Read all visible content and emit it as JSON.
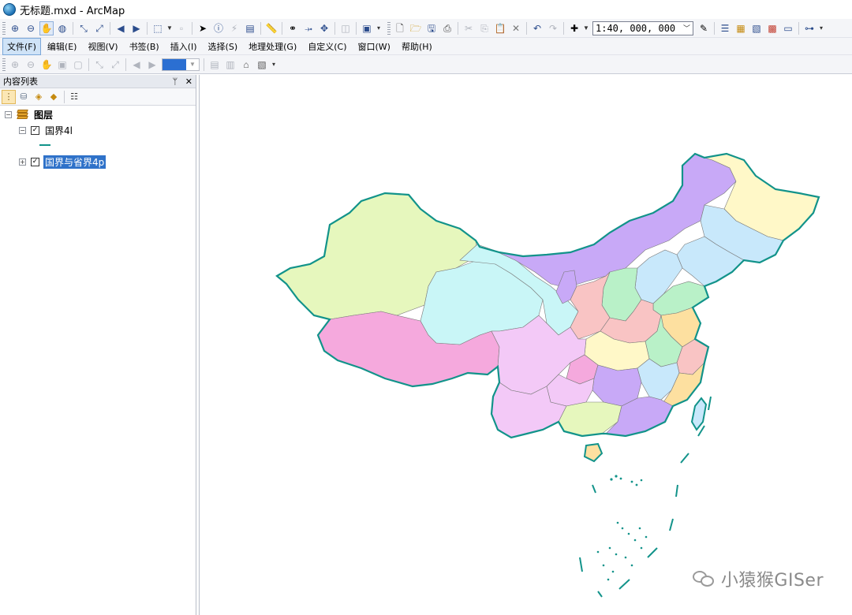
{
  "window": {
    "title": "无标题.mxd - ArcMap"
  },
  "menubar": {
    "items": [
      "文件(F)",
      "编辑(E)",
      "视图(V)",
      "书签(B)",
      "插入(I)",
      "选择(S)",
      "地理处理(G)",
      "自定义(C)",
      "窗口(W)",
      "帮助(H)"
    ],
    "active_index": 0
  },
  "standard_toolbar": {
    "scale_value": "1:40, 000, 000"
  },
  "toc": {
    "title": "内容列表",
    "layers_root": "图层",
    "layers": [
      {
        "name": "国界4l",
        "checked": true,
        "expanded": true,
        "symbol_color": "#12938a"
      },
      {
        "name": "国界与省界4p",
        "checked": true,
        "expanded": false,
        "selected": true
      }
    ]
  },
  "map": {
    "boundary_color": "#12938a",
    "province_colors": [
      "#e6f7bd",
      "#f5a9dd",
      "#c9f6f7",
      "#c8a9f7",
      "#fff8c8",
      "#c8e8fb",
      "#f9c4c4",
      "#b9f1c8",
      "#f3c9f7",
      "#fde0a0"
    ],
    "watermark": "小猿猴GISer"
  }
}
